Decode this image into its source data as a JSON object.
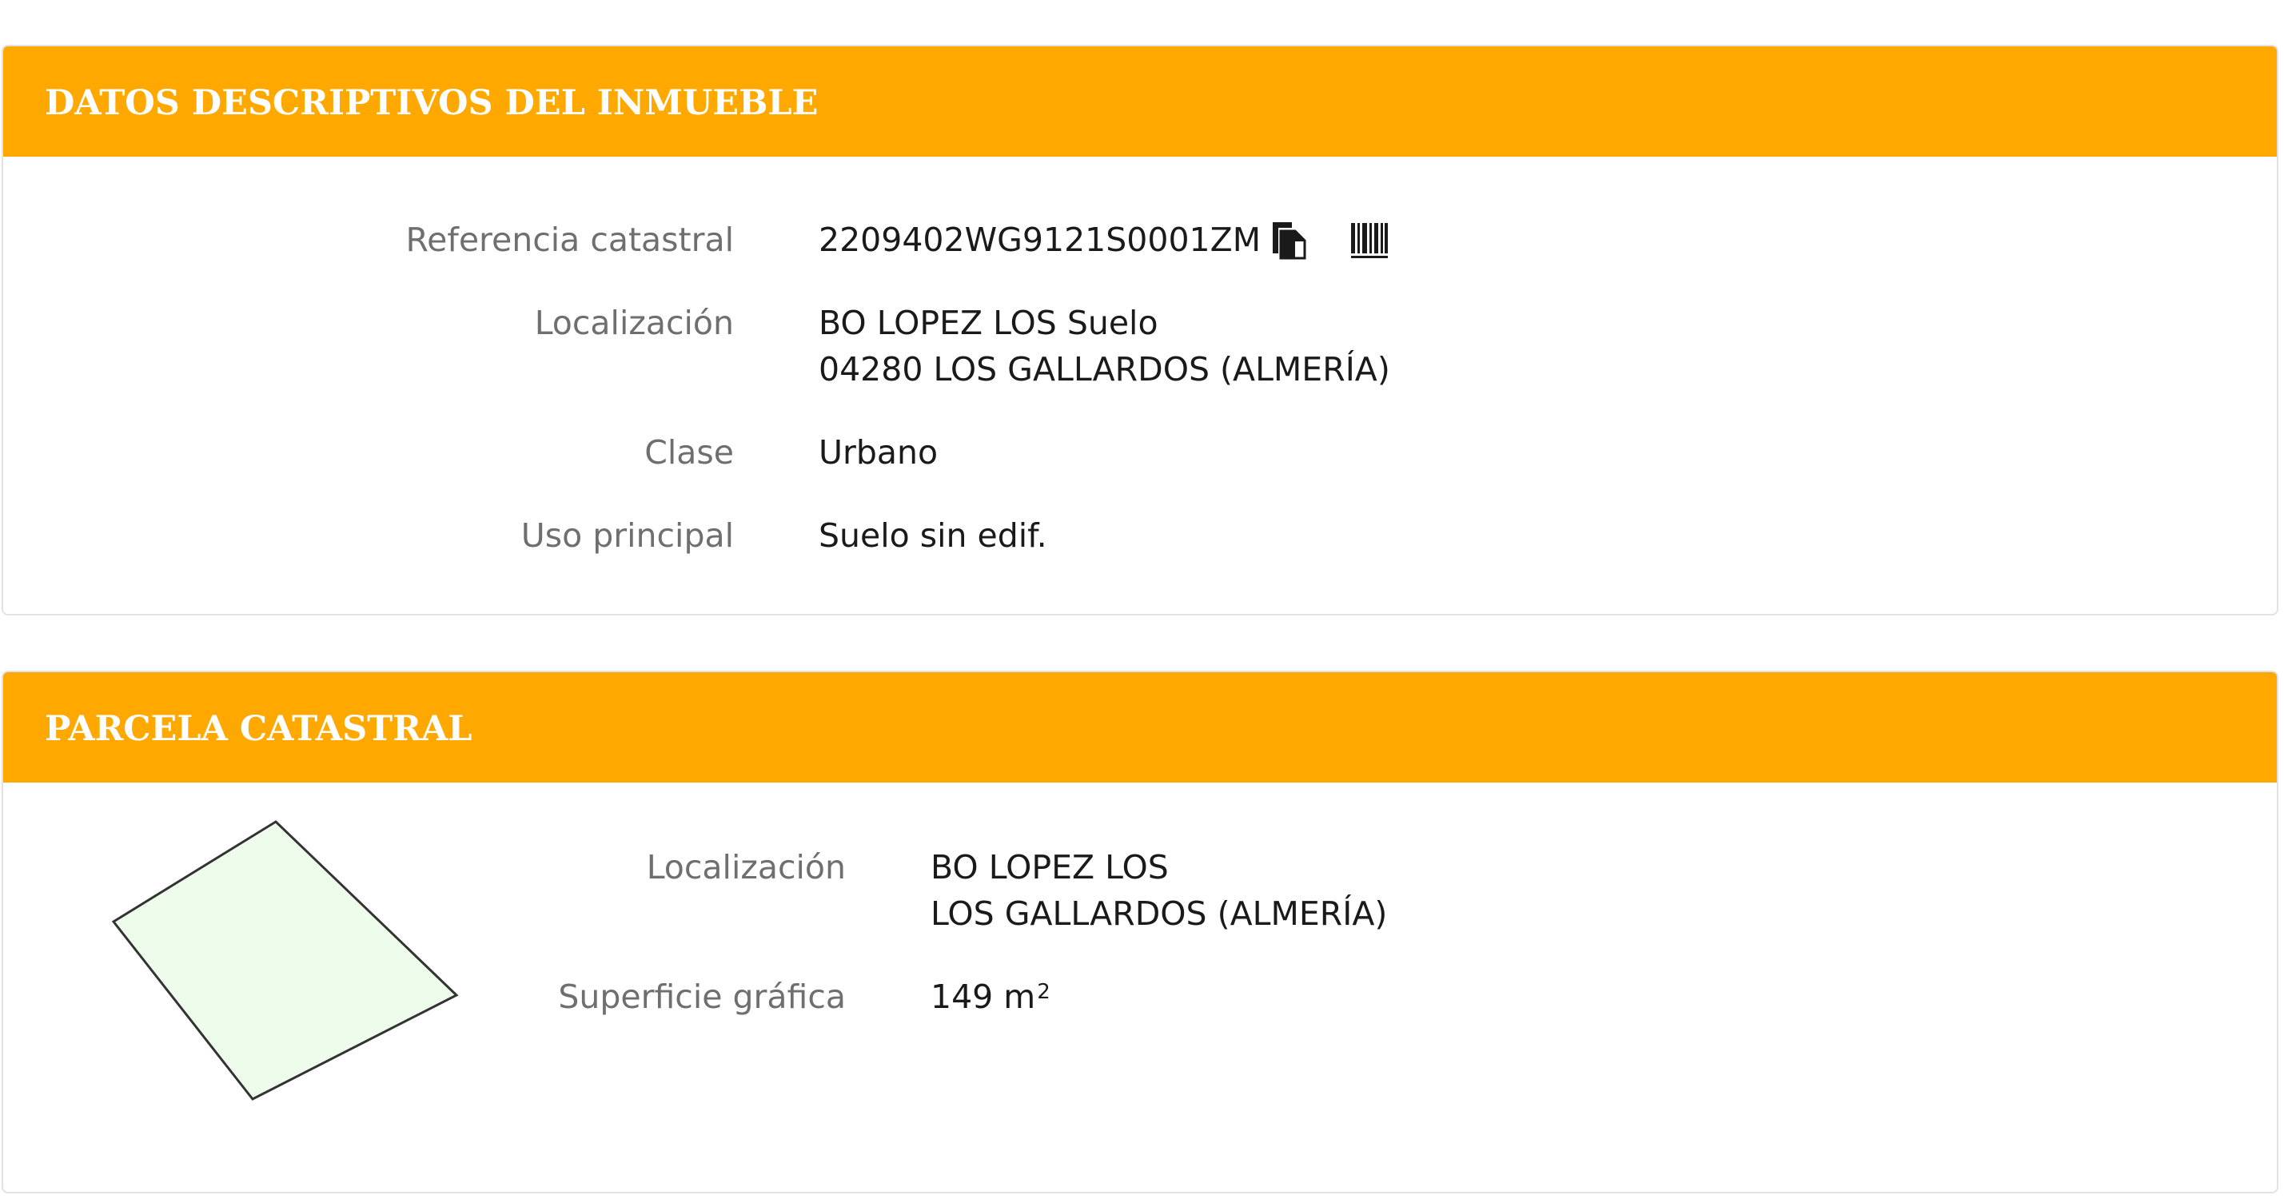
{
  "inmueble": {
    "title": "DATOS DESCRIPTIVOS DEL INMUEBLE",
    "referencia": {
      "label": "Referencia catastral",
      "value": "2209402WG9121S0001ZM",
      "copy_icon": "copy-icon",
      "barcode_icon": "barcode-icon"
    },
    "localizacion": {
      "label": "Localización",
      "line1": "BO LOPEZ LOS Suelo",
      "line2": "04280 LOS GALLARDOS (ALMERÍA)"
    },
    "clase": {
      "label": "Clase",
      "value": "Urbano"
    },
    "uso": {
      "label": "Uso principal",
      "value": "Suelo sin edif."
    }
  },
  "parcela": {
    "title": "PARCELA CATASTRAL",
    "localizacion": {
      "label": "Localización",
      "line1": "BO LOPEZ LOS",
      "line2": "LOS GALLARDOS (ALMERÍA)"
    },
    "superficie": {
      "label": "Superficie gráfica",
      "value": "149 m",
      "exponent": "2"
    },
    "shape": {
      "fill": "#eefcec",
      "stroke": "#333333"
    }
  },
  "colors": {
    "header": "#ffa800",
    "label": "#6f6f6f",
    "value": "#1a1a1a",
    "border": "#e2e2e2"
  }
}
